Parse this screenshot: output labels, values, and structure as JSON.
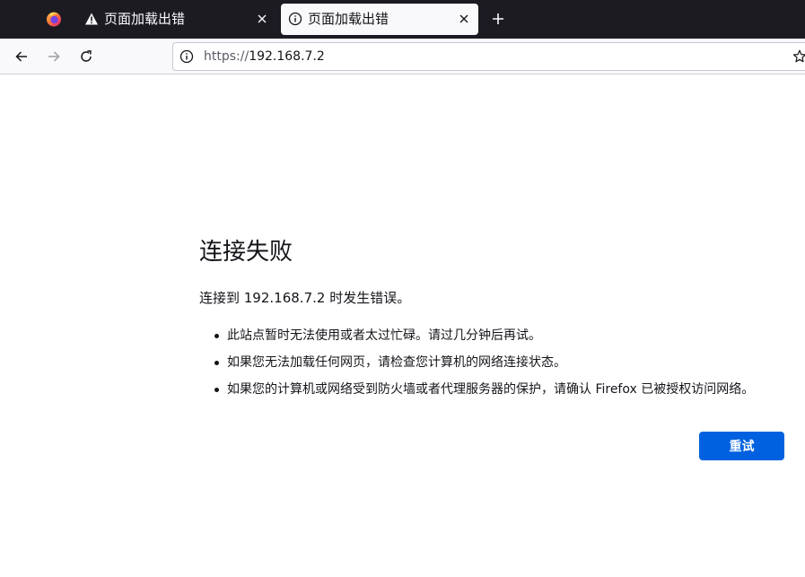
{
  "browser": {
    "brand_icon": "firefox-logo-icon",
    "tabs": [
      {
        "title": "页面加载出错",
        "icon": "warning-triangle-icon",
        "active": false
      },
      {
        "title": "页面加载出错",
        "icon": "info-circle-icon",
        "active": true
      }
    ],
    "new_tab_icon": "plus-icon"
  },
  "navbar": {
    "url_scheme": "https://",
    "url_host": "192.168.7.2",
    "back_icon": "arrow-left-icon",
    "forward_icon": "arrow-right-icon",
    "reload_icon": "reload-icon",
    "site_info_icon": "info-circle-icon",
    "bookmark_icon": "star-icon"
  },
  "error": {
    "title": "连接失败",
    "description": "连接到 192.168.7.2 时发生错误。",
    "suggestions": [
      "此站点暂时无法使用或者太过忙碌。请过几分钟后再试。",
      "如果您无法加载任何网页，请检查您计算机的网络连接状态。",
      "如果您的计算机或网络受到防火墙或者代理服务器的保护，请确认 Firefox 已被授权访问网络。"
    ],
    "retry_label": "重试"
  },
  "colors": {
    "tabbar_bg": "#1c1b22",
    "primary_button": "#0061e0",
    "text": "#15141a"
  }
}
